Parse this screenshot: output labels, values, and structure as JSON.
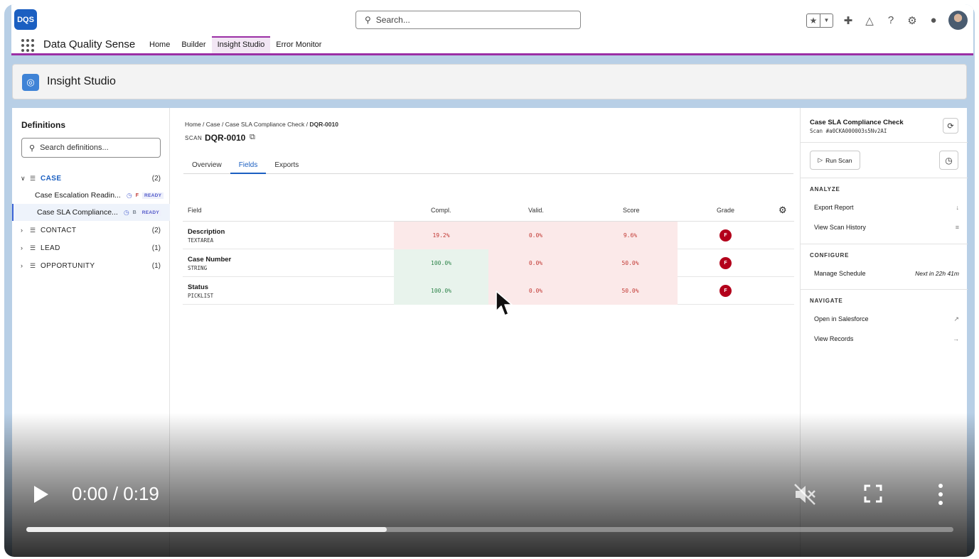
{
  "header": {
    "logo_text": "DQS",
    "search_placeholder": "Search...",
    "icons": [
      "star-icon",
      "chevron-down-icon",
      "plus-icon",
      "trailhead-icon",
      "help-icon",
      "gear-icon",
      "bell-icon",
      "avatar"
    ]
  },
  "nav": {
    "app_name": "Data Quality Sense",
    "tabs": [
      {
        "label": "Home",
        "active": false
      },
      {
        "label": "Builder",
        "active": false
      },
      {
        "label": "Insight Studio",
        "active": true
      },
      {
        "label": "Error Monitor",
        "active": false
      }
    ],
    "accent": "#9b2fa5"
  },
  "page_header": {
    "title": "Insight Studio"
  },
  "definitions": {
    "title": "Definitions",
    "search_placeholder": "Search definitions...",
    "groups": [
      {
        "label": "CASE",
        "count": "(2)",
        "expanded": true,
        "children": [
          {
            "name": "Case Escalation Readin...",
            "grade": "F",
            "status": "READY",
            "selected": false
          },
          {
            "name": "Case SLA Compliance...",
            "grade": "B",
            "status": "READY",
            "selected": true
          }
        ]
      },
      {
        "label": "CONTACT",
        "count": "(2)",
        "expanded": false
      },
      {
        "label": "LEAD",
        "count": "(1)",
        "expanded": false
      },
      {
        "label": "OPPORTUNITY",
        "count": "(1)",
        "expanded": false
      }
    ]
  },
  "breadcrumb": {
    "items": [
      "Home",
      "Case",
      "Case SLA Compliance Check"
    ],
    "current": "DQR-0010"
  },
  "scan": {
    "label": "SCAN",
    "id": "DQR-0010"
  },
  "tabs": [
    {
      "label": "Overview",
      "active": false
    },
    {
      "label": "Fields",
      "active": true
    },
    {
      "label": "Exports",
      "active": false
    }
  ],
  "table": {
    "headers": {
      "field": "Field",
      "compl": "Compl.",
      "valid": "Valid.",
      "score": "Score",
      "grade": "Grade"
    },
    "rows": [
      {
        "name": "Description",
        "type": "TEXTAREA",
        "compl": "19.2%",
        "valid": "0.0%",
        "score": "9.6%",
        "grade": "F",
        "compl_status": "bad"
      },
      {
        "name": "Case Number",
        "type": "STRING",
        "compl": "100.0%",
        "valid": "0.0%",
        "score": "50.0%",
        "grade": "F",
        "compl_status": "good"
      },
      {
        "name": "Status",
        "type": "PICKLIST",
        "compl": "100.0%",
        "valid": "0.0%",
        "score": "50.0%",
        "grade": "F",
        "compl_status": "good"
      }
    ]
  },
  "side": {
    "title": "Case SLA Compliance Check",
    "subtitle": "Scan #a0CKA000003s5Nv2AI",
    "run_label": "Run Scan",
    "analyze_title": "ANALYZE",
    "configure_title": "CONFIGURE",
    "navigate_title": "NAVIGATE",
    "export_report": "Export Report",
    "view_history": "View Scan History",
    "manage_schedule": "Manage Schedule",
    "next_run": "Next in 22h 41m",
    "open_salesforce": "Open in Salesforce",
    "view_records": "View Records"
  },
  "video": {
    "time": "0:00 / 0:19",
    "progress": 0.389
  }
}
